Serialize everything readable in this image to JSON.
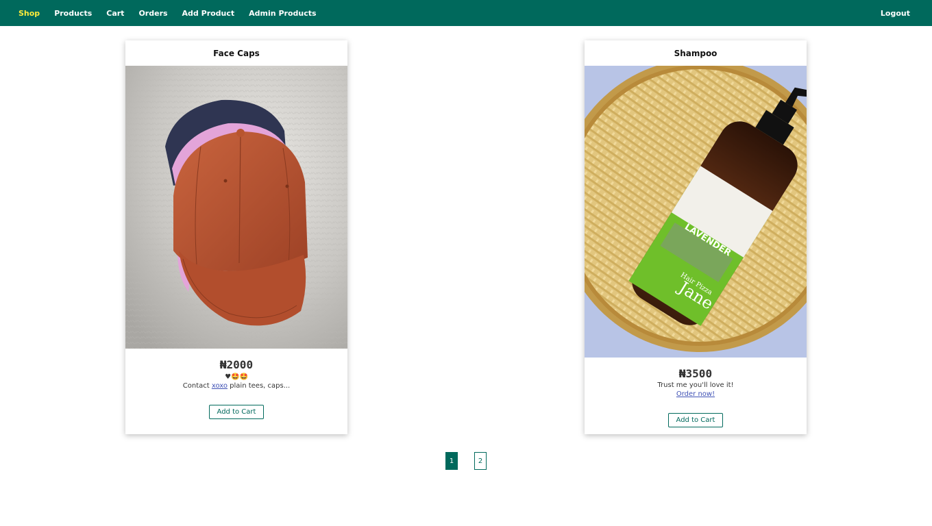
{
  "nav": {
    "items": [
      {
        "label": "Shop",
        "active": true
      },
      {
        "label": "Products",
        "active": false
      },
      {
        "label": "Cart",
        "active": false
      },
      {
        "label": "Orders",
        "active": false
      },
      {
        "label": "Add Product",
        "active": false
      },
      {
        "label": "Admin Products",
        "active": false
      }
    ],
    "logout_label": "Logout"
  },
  "products": [
    {
      "title": "Face Caps",
      "price": "₦2000",
      "emoji_line": "♥🤩🤩",
      "desc_prefix": "Contact ",
      "desc_link": "xoxo",
      "desc_suffix": " plain tees, caps...",
      "image_icon": "cap-photo",
      "add_to_cart_label": "Add to Cart"
    },
    {
      "title": "Shampoo",
      "price": "₦3500",
      "desc_line": "Trust me you'll love it!",
      "desc_link": "Order now!",
      "image_icon": "shampoo-photo",
      "bottle_label": {
        "brand": "Jane",
        "sub": "Hair Pizza",
        "name": "LAVENDER"
      },
      "add_to_cart_label": "Add to Cart"
    }
  ],
  "pagination": {
    "current": "1",
    "other": "2"
  },
  "colors": {
    "primary": "#00695c",
    "active_nav": "#ffeb3b",
    "link": "#3f51b5"
  }
}
